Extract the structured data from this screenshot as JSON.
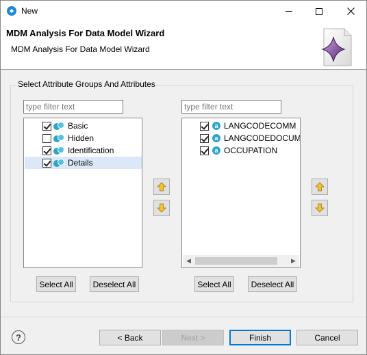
{
  "window": {
    "title": "New"
  },
  "header": {
    "title": "MDM Analysis For Data Model Wizard",
    "subtitle": "MDM Analysis For Data Model Wizard"
  },
  "group": {
    "label": "Select Attribute Groups And Attributes"
  },
  "left_panel": {
    "filter_placeholder": "type filter text",
    "filter_value": "",
    "items": [
      {
        "label": "Basic",
        "checked": true,
        "selected": false
      },
      {
        "label": "Hidden",
        "checked": false,
        "selected": false
      },
      {
        "label": "Identification",
        "checked": true,
        "selected": false
      },
      {
        "label": "Details",
        "checked": true,
        "selected": true
      }
    ],
    "select_all_label": "Select All",
    "deselect_all_label": "Deselect All"
  },
  "right_panel": {
    "filter_placeholder": "type filter text",
    "filter_value": "",
    "items": [
      {
        "label": "LANGCODECOMM",
        "checked": true
      },
      {
        "label": "LANGCODEDOCUMI",
        "checked": true
      },
      {
        "label": "OCCUPATION",
        "checked": true
      }
    ],
    "select_all_label": "Select All",
    "deselect_all_label": "Deselect All"
  },
  "icons": {
    "group_icon": "attribute-group-icon",
    "attribute_icon": "attribute-icon",
    "attribute_icon_letter": "a",
    "move_up": "arrow-up-icon",
    "move_down": "arrow-down-icon",
    "help": "help-icon",
    "help_glyph": "?"
  },
  "colors": {
    "accent": "#0078d7",
    "icon_blue": "#2ea4c6",
    "selection": "#dce8f8",
    "move_arrow": "#f2c230"
  },
  "footer": {
    "back_label": "< Back",
    "next_label": "Next >",
    "finish_label": "Finish",
    "cancel_label": "Cancel"
  }
}
